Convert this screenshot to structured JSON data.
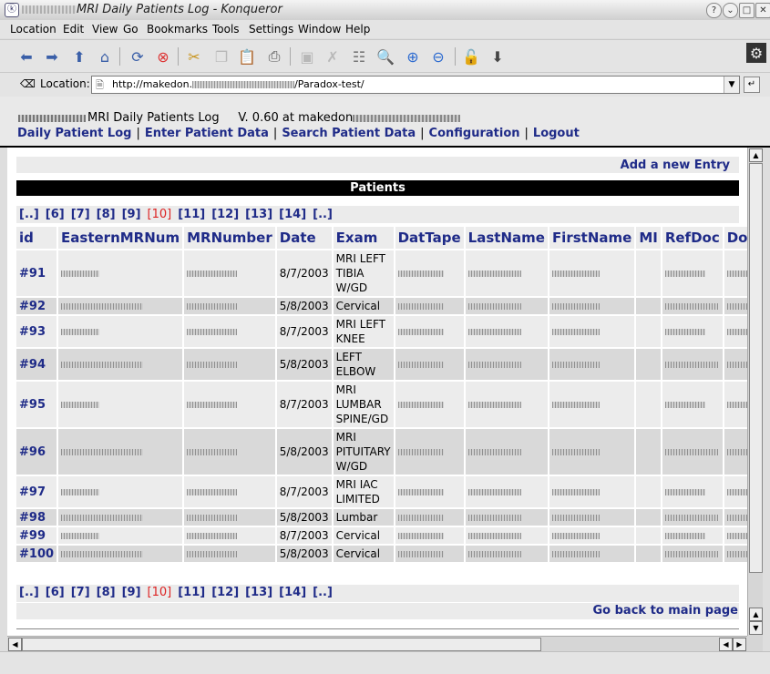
{
  "window": {
    "title": "MRI Daily Patients Log - Konqueror",
    "help_btn": "?",
    "min_btn": "⌄",
    "max_btn": "□",
    "close_btn": "✕"
  },
  "menu": [
    "Location",
    "Edit",
    "View",
    "Go",
    "Bookmarks",
    "Tools",
    "Settings",
    "Window",
    "Help"
  ],
  "location": {
    "label": "Location:",
    "url_prefix": "http://makedon.",
    "url_suffix": "/Paradox-test/"
  },
  "header": {
    "app_title": "MRI Daily Patients Log",
    "version": "V. 0.60 at makedon",
    "nav": [
      "Daily Patient Log",
      "Enter Patient Data",
      "Search Patient Data",
      "Configuration",
      "Logout"
    ]
  },
  "content": {
    "add_new": "Add a new Entry",
    "section_title": "Patients",
    "pager": [
      "[..]",
      "[6]",
      "[7]",
      "[8]",
      "[9]",
      "[10]",
      "[11]",
      "[12]",
      "[13]",
      "[14]",
      "[..]"
    ],
    "pager_current": "[10]",
    "back_link": "Go back to main page"
  },
  "table": {
    "columns": [
      "id",
      "EasternMRNum",
      "MRNumber",
      "Date",
      "Exam",
      "DatTape",
      "LastName",
      "FirstName",
      "MI",
      "RefDoc",
      "DocFirstN"
    ],
    "rows": [
      {
        "id": "#91",
        "date": "8/7/2003",
        "exam": "MRI LEFT TIBIA W/GD"
      },
      {
        "id": "#92",
        "date": "5/8/2003",
        "exam": "Cervical"
      },
      {
        "id": "#93",
        "date": "8/7/2003",
        "exam": "MRI LEFT KNEE"
      },
      {
        "id": "#94",
        "date": "5/8/2003",
        "exam": "LEFT ELBOW"
      },
      {
        "id": "#95",
        "date": "8/7/2003",
        "exam": "MRI LUMBAR SPINE/GD"
      },
      {
        "id": "#96",
        "date": "5/8/2003",
        "exam": "MRI PITUITARY W/GD"
      },
      {
        "id": "#97",
        "date": "8/7/2003",
        "exam": "MRI IAC LIMITED"
      },
      {
        "id": "#98",
        "date": "5/8/2003",
        "exam": "Lumbar"
      },
      {
        "id": "#99",
        "date": "8/7/2003",
        "exam": "Cervical"
      },
      {
        "id": "#100",
        "date": "5/8/2003",
        "exam": "Cervical"
      }
    ]
  },
  "colors": {
    "link": "#1f2b88",
    "current_page": "#d22222",
    "header_bar": "#000000"
  }
}
